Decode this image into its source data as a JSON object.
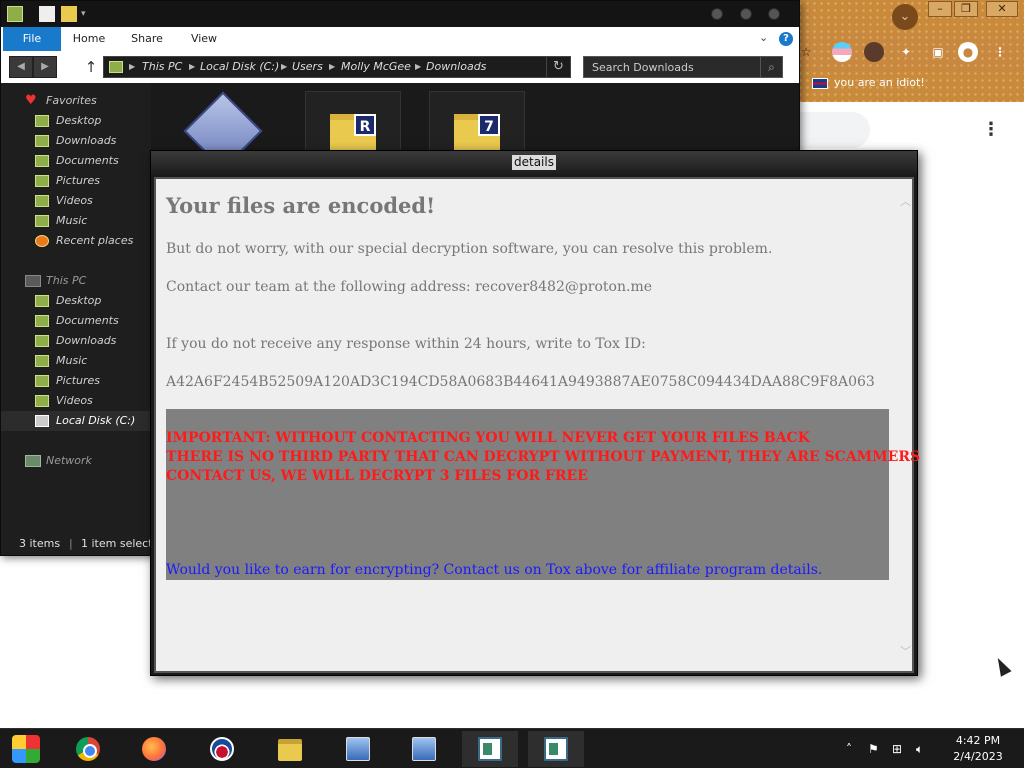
{
  "browser": {
    "bookmark_label": "you are an idiot!",
    "menu_glyph": "chevron-down-icon",
    "window_controls": [
      "–",
      "❐",
      "✕"
    ]
  },
  "explorer": {
    "ribbon_tabs": [
      "File",
      "Home",
      "Share",
      "View"
    ],
    "address": [
      "This PC",
      "Local Disk (C:)",
      "Users",
      "Molly McGee",
      "Downloads"
    ],
    "search_placeholder": "Search Downloads",
    "nav": {
      "favorites": {
        "label": "Favorites",
        "items": [
          "Desktop",
          "Downloads",
          "Documents",
          "Pictures",
          "Videos",
          "Music",
          "Recent places"
        ]
      },
      "this_pc": {
        "label": "This PC",
        "items": [
          "Desktop",
          "Documents",
          "Downloads",
          "Music",
          "Pictures",
          "Videos",
          "Local Disk (C:)"
        ]
      },
      "network": {
        "label": "Network"
      }
    },
    "file_badges": [
      "R",
      "7"
    ],
    "status": {
      "items": "3 items",
      "selected": "1 item select"
    }
  },
  "details_window": {
    "title": "details",
    "heading": "Your files are encoded!",
    "line1": "But do not worry, with our special decryption software, you can resolve this problem.",
    "line2": "Contact our team at the following address: recover8482@proton.me",
    "line3": "If you do not receive any response within 24 hours, write to Tox ID:",
    "tox_id": "A42A6F2454B52509A120AD3C194CD58A0683B44641A9493887AE0758C094434DAA88C9F8A063",
    "warning1": "IMPORTANT: WITHOUT CONTACTING YOU WILL NEVER GET YOUR FILES BACK",
    "warning2": "THERE IS NO THIRD PARTY THAT CAN DECRYPT WITHOUT PAYMENT, THEY ARE SCAMMERS",
    "warning3": "CONTACT US, WE WILL DECRYPT 3 FILES FOR FREE",
    "affiliate": "Would you like to earn for encrypting? Contact us on Tox above for affiliate program details.",
    "colors": {
      "warning": "#ff1a1a",
      "affiliate": "#1a1aff",
      "block": "#808080"
    }
  },
  "taskbar": {
    "apps": [
      "start-icon",
      "chrome-icon",
      "firefox-icon",
      "obama-icon",
      "file-explorer-icon",
      "network-icon",
      "network-icon",
      "document-icon",
      "document-icon"
    ],
    "time": "4:42 PM",
    "date": "2/4/2023"
  }
}
